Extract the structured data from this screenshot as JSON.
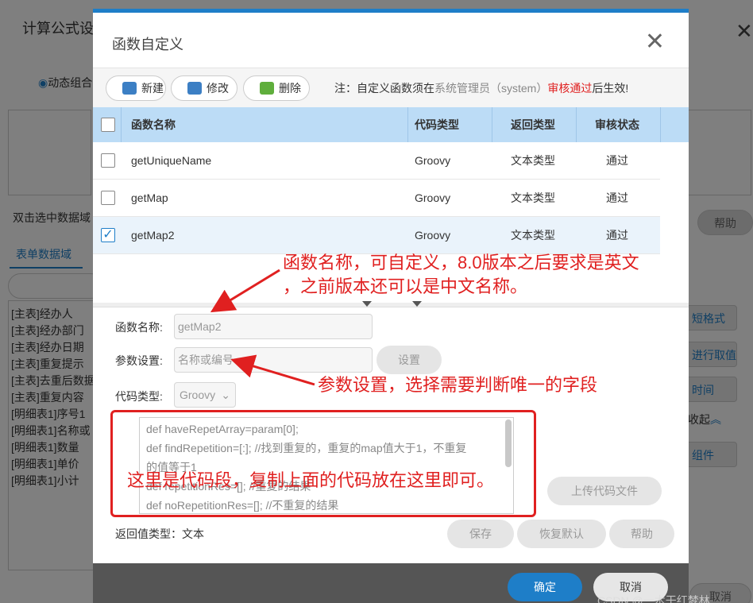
{
  "background": {
    "window_title": "计算公式设",
    "radio_label": "动态组合",
    "hint": "双击选中数据域",
    "tab_label": "表单数据域",
    "fields": [
      "[主表]经办人",
      "[主表]经办部门",
      "[主表]经办日期",
      "[主表]重复提示",
      "[主表]去重后数据",
      "[主表]重复内容",
      "[明细表1]序号1",
      "[明细表1]名称或",
      "[明细表1]数量",
      "[明细表1]单价",
      "[明细表1]小计"
    ],
    "help_label": "帮助",
    "right_buttons": [
      "短格式",
      "进行取值",
      "时间",
      "组件"
    ],
    "collapse_label": "收起",
    "cancel_label": "取消"
  },
  "dialog": {
    "title": "函数自定义",
    "toolbar": {
      "new_label": "新建",
      "edit_label": "修改",
      "delete_label": "删除"
    },
    "notice": {
      "prefix": "注：自定义函数须在",
      "role": "系统管理员（system）",
      "audit": "审核通过",
      "suffix": "后生效!"
    },
    "grid": {
      "headers": [
        "函数名称",
        "代码类型",
        "返回类型",
        "审核状态"
      ],
      "rows": [
        {
          "name": "getUniqueName",
          "code_type": "Groovy",
          "return_type": "文本类型",
          "status": "通过",
          "checked": false
        },
        {
          "name": "getMap",
          "code_type": "Groovy",
          "return_type": "文本类型",
          "status": "通过",
          "checked": false
        },
        {
          "name": "getMap2",
          "code_type": "Groovy",
          "return_type": "文本类型",
          "status": "通过",
          "checked": true
        }
      ]
    },
    "form": {
      "name_label": "函数名称:",
      "name_value": "getMap2",
      "param_label": "参数设置:",
      "param_placeholder": "名称或编号",
      "param_button": "设置",
      "code_type_label": "代码类型:",
      "code_type_value": "Groovy",
      "code_lines": [
        "def haveRepetArray=param[0];",
        "def findRepetition=[:];  //找到重复的，重复的map值大于1，不重复",
        "的值等于1",
        "def repetitionRes=[];   //重复的结果",
        "def noRepetitionRes=[];  //不重复的结果"
      ],
      "upload_button": "上传代码文件",
      "return_label": "返回值类型：文本",
      "save_button": "保存",
      "reset_button": "恢复默认",
      "help_button": "帮助"
    },
    "footer": {
      "ok_label": "确定",
      "cancel_label": "取消"
    }
  },
  "annotations": {
    "name_note_line1": "函数名称，可自定义，8.0版本之后要求是英文",
    "name_note_line2": "，之前版本还可以是中文名称。",
    "param_note": "参数设置，选择需要判断唯一的字段",
    "code_note": "这里是代码段，复制上面的代码放在这里即可。"
  },
  "watermark": "CSDN @一木干红梦林",
  "colors": {
    "accent": "#1e7ec8",
    "header_bg": "#bcdcf6",
    "annotation_red": "#e02020"
  }
}
